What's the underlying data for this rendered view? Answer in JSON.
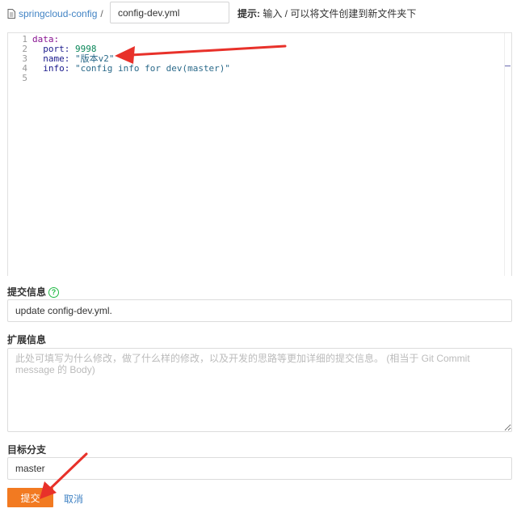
{
  "path": {
    "repo": "springcloud-config",
    "separator": "/",
    "filename": "config-dev.yml"
  },
  "hint": {
    "bold": "提示:",
    "text": " 输入 / 可以将文件创建到新文件夹下"
  },
  "editor": {
    "lines": [
      {
        "num": "1",
        "indent": "",
        "key": "data:",
        "value": ""
      },
      {
        "num": "2",
        "indent": "  ",
        "key": "port:",
        "value": " 9998"
      },
      {
        "num": "3",
        "indent": "  ",
        "key": "name:",
        "value": " \"版本v2\""
      },
      {
        "num": "4",
        "indent": "  ",
        "key": "info:",
        "value": " \"config info for dev(master)\""
      },
      {
        "num": "5",
        "indent": "",
        "key": "",
        "value": ""
      }
    ]
  },
  "commit": {
    "label": "提交信息",
    "value": "update config-dev.yml."
  },
  "extended": {
    "label": "扩展信息",
    "placeholder": "此处可填写为什么修改，做了什么样的修改，以及开发的思路等更加详细的提交信息。 (相当于 Git Commit message 的 Body)"
  },
  "branch": {
    "label": "目标分支",
    "value": "master"
  },
  "actions": {
    "submit": "提交",
    "cancel": "取消"
  },
  "colors": {
    "accent": "#f27a21",
    "link": "#4183c4",
    "arrow": "#e8312a"
  }
}
